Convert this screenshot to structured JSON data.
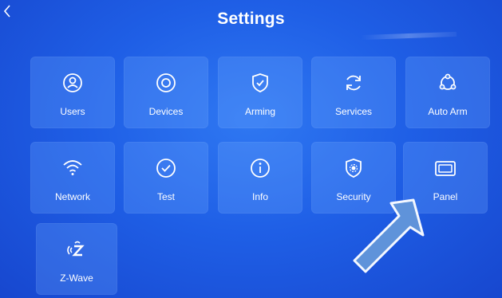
{
  "header": {
    "title": "Settings",
    "back_icon": "chevron-left-icon"
  },
  "tiles": [
    {
      "label": "Users",
      "icon": "user-circle-icon"
    },
    {
      "label": "Devices",
      "icon": "devices-icon"
    },
    {
      "label": "Arming",
      "icon": "shield-check-icon"
    },
    {
      "label": "Services",
      "icon": "refresh-icon"
    },
    {
      "label": "Auto Arm",
      "icon": "auto-arm-icon"
    },
    {
      "label": "Network",
      "icon": "wifi-icon"
    },
    {
      "label": "Test",
      "icon": "check-circle-icon"
    },
    {
      "label": "Info",
      "icon": "info-icon"
    },
    {
      "label": "Security",
      "icon": "shield-gear-icon"
    },
    {
      "label": "Panel",
      "icon": "panel-icon"
    },
    {
      "label": "Z-Wave",
      "icon": "zwave-icon"
    }
  ],
  "colors": {
    "background": "#1f5fe6",
    "tile": "#5f97f5",
    "arrow": "#5f93da"
  }
}
